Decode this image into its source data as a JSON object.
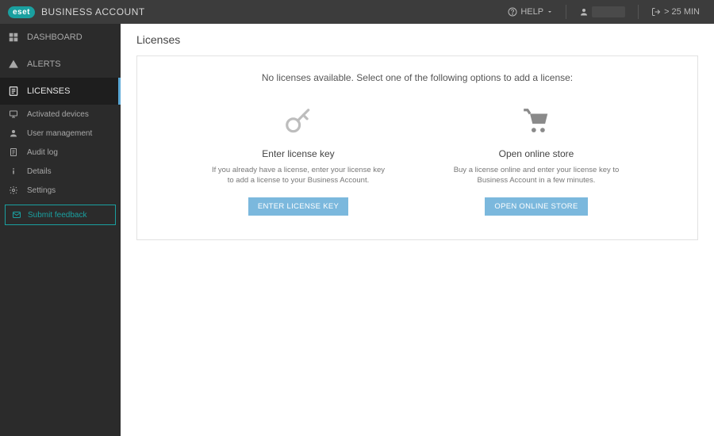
{
  "header": {
    "brand_logo": "eset",
    "brand_title": "BUSINESS ACCOUNT",
    "help_label": "HELP",
    "timeout_label": "> 25 MIN"
  },
  "sidebar": {
    "dashboard": "DASHBOARD",
    "alerts": "ALERTS",
    "licenses": "LICENSES",
    "activated_devices": "Activated devices",
    "user_management": "User management",
    "audit_log": "Audit log",
    "details": "Details",
    "settings": "Settings",
    "submit_feedback": "Submit feedback"
  },
  "main": {
    "page_title": "Licenses",
    "intro": "No licenses available. Select one of the following options to add a license:",
    "option_a": {
      "title": "Enter license key",
      "desc": "If you already have a license, enter your license key to add a license to your Business Account.",
      "button": "ENTER LICENSE KEY"
    },
    "option_b": {
      "title": "Open online store",
      "desc": "Buy a license online and enter your license key to Business Account in a few minutes.",
      "button": "OPEN ONLINE STORE"
    }
  }
}
